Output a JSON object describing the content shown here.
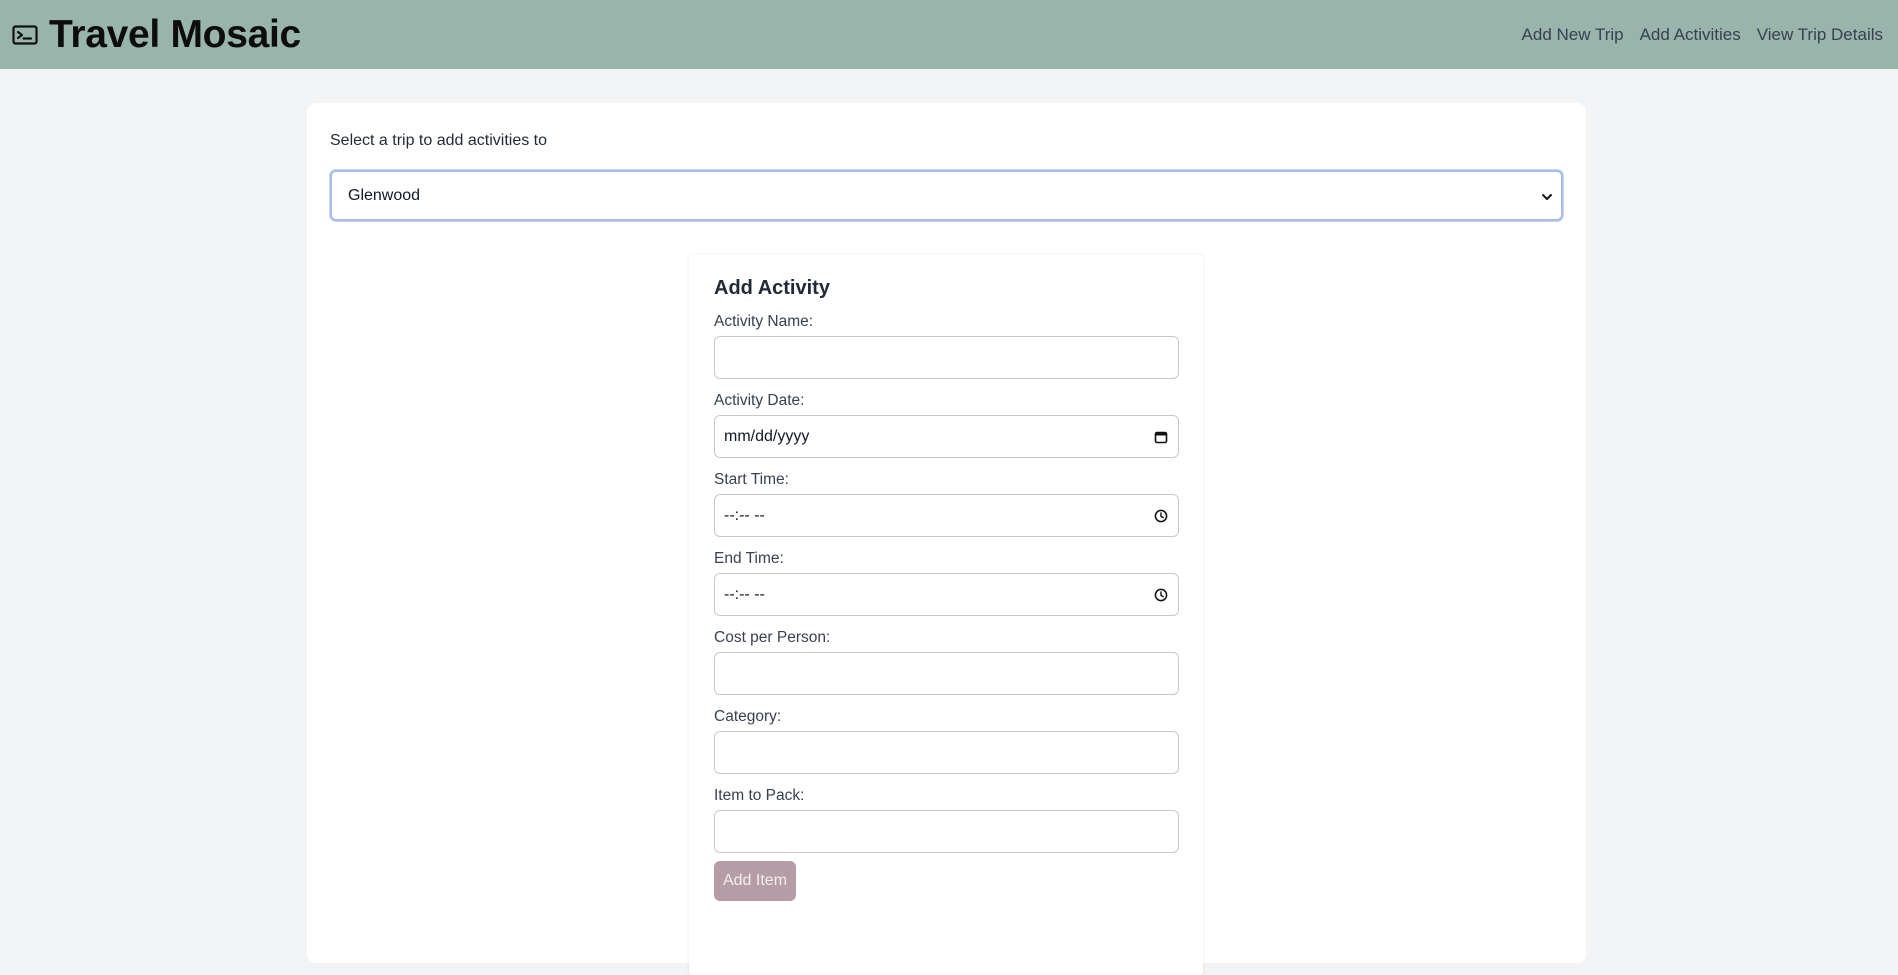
{
  "app": {
    "title": "Travel Mosaic",
    "brand_icon": "ticket-icon"
  },
  "nav": {
    "links": [
      {
        "label": "Add New Trip"
      },
      {
        "label": "Add Activities"
      },
      {
        "label": "View Trip Details"
      }
    ]
  },
  "trip_select": {
    "label": "Select a trip to add activities to",
    "selected": "Glenwood"
  },
  "form": {
    "title": "Add Activity",
    "activity_name": {
      "label": "Activity Name:",
      "value": ""
    },
    "activity_date": {
      "label": "Activity Date:",
      "placeholder": "mm/dd/yyyy",
      "icon": "calendar-icon"
    },
    "start_time": {
      "label": "Start Time:",
      "placeholder": "--:-- --",
      "icon": "clock-icon"
    },
    "end_time": {
      "label": "End Time:",
      "placeholder": "--:-- --",
      "icon": "clock-icon"
    },
    "cost_per_person": {
      "label": "Cost per Person:",
      "value": ""
    },
    "category": {
      "label": "Category:",
      "value": ""
    },
    "item_to_pack": {
      "label": "Item to Pack:",
      "value": ""
    },
    "add_item_label": "Add Item"
  },
  "colors": {
    "navbar_bg": "#99b4ab",
    "page_bg": "#f2f3f5",
    "button_bg": "#b59ca6",
    "select_focus_border": "#a7bcec"
  }
}
